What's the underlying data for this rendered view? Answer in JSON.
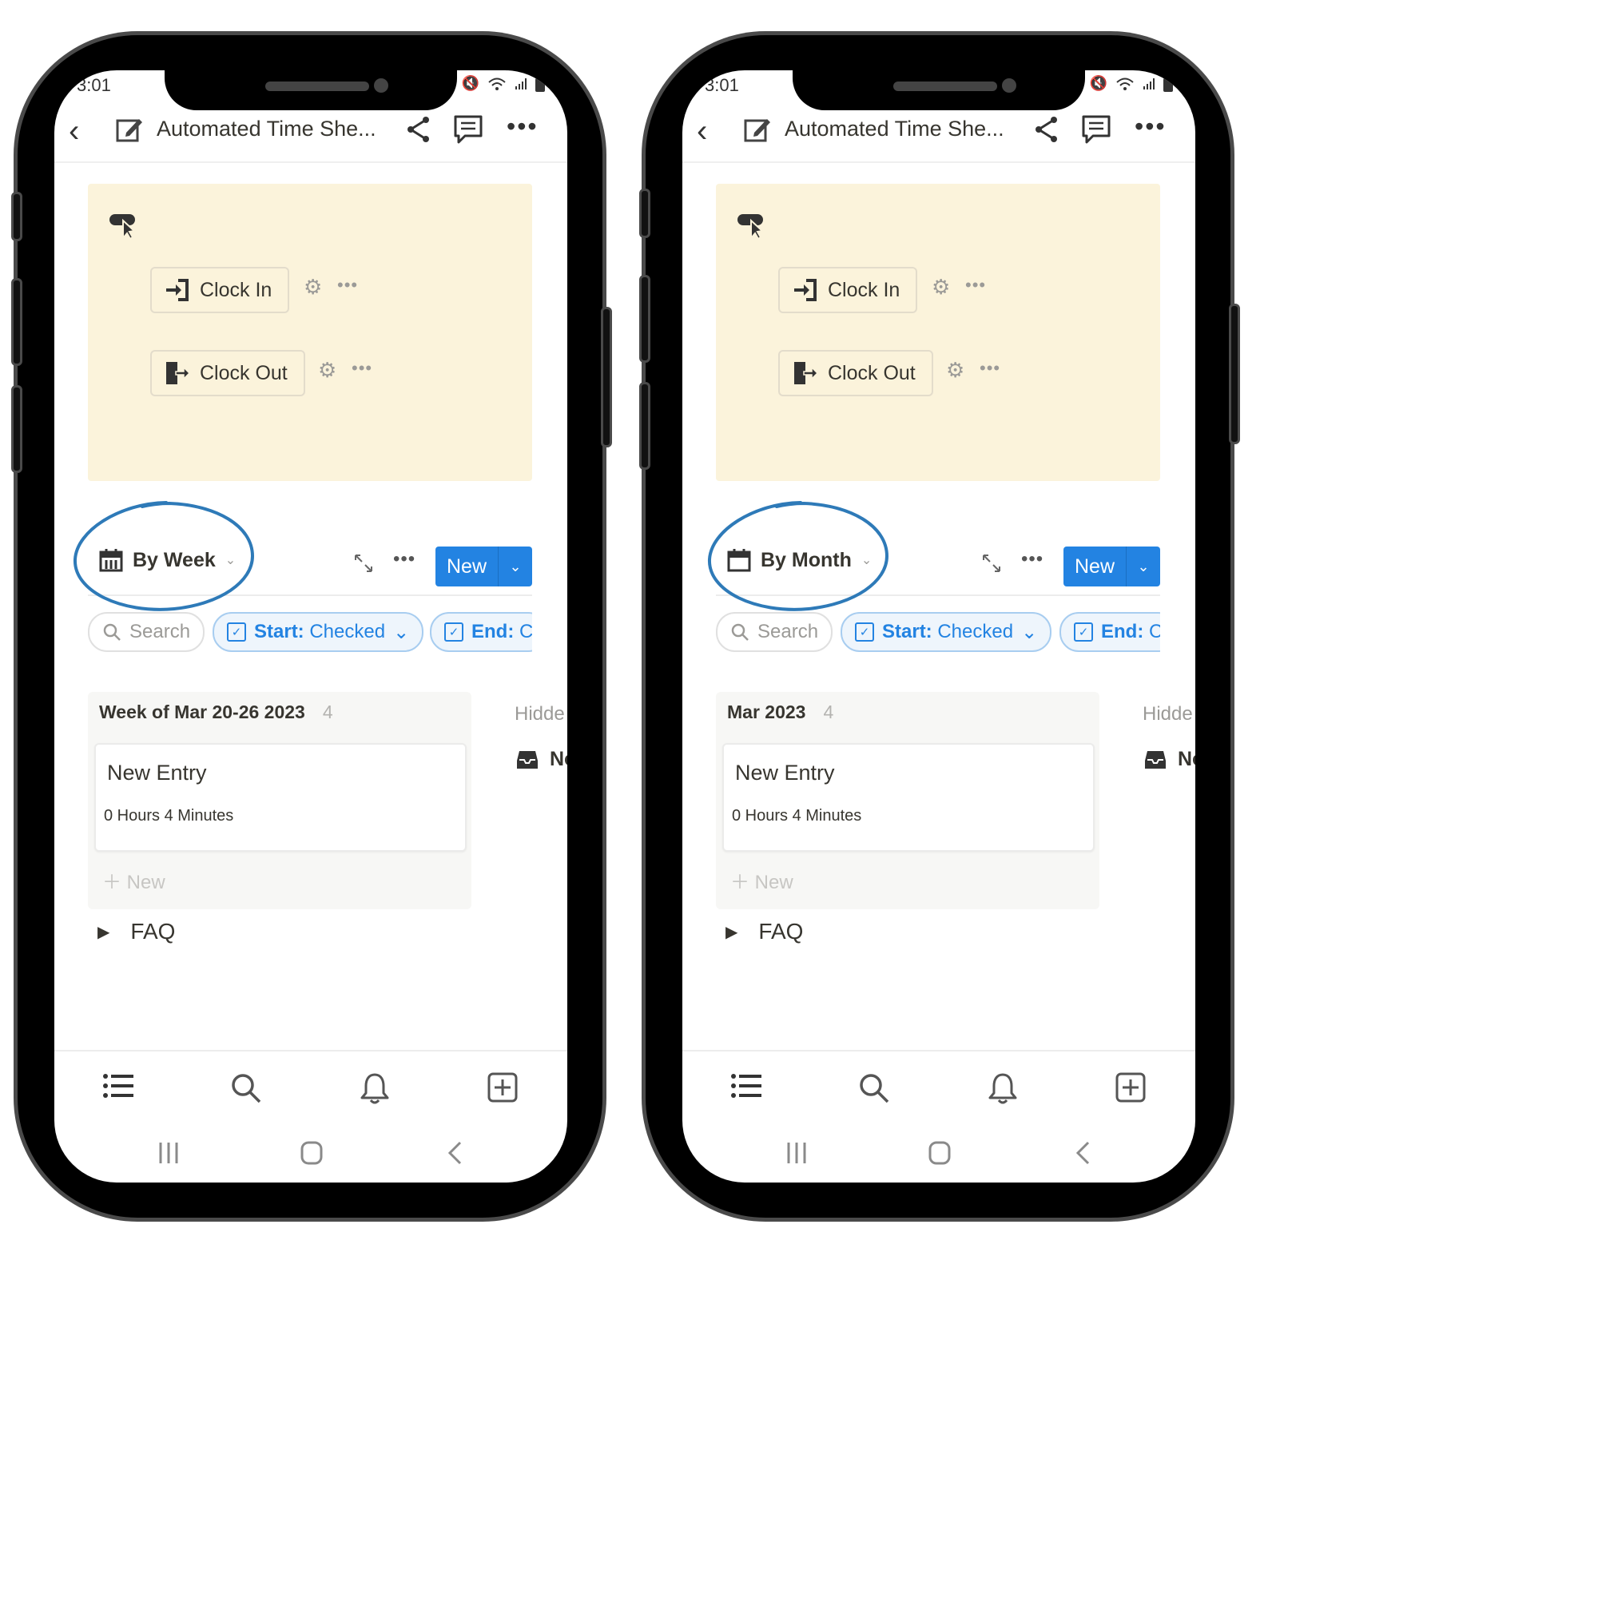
{
  "phones": [
    {
      "status": {
        "time": "3:01"
      },
      "header": {
        "title": "Automated Time She..."
      },
      "callout": {
        "clock_in": "Clock In",
        "clock_out": "Clock Out"
      },
      "view": {
        "label": "By Week",
        "new_button": "New"
      },
      "filters": {
        "search": "Search",
        "start_key": "Start:",
        "start_val": " Checked",
        "end_key": "End:",
        "end_val": " C"
      },
      "group": {
        "title": "Week of Mar 20-26 2023",
        "count": "4",
        "new_label": "New"
      },
      "card": {
        "title": "New Entry",
        "subtitle": "0 Hours 4 Minutes"
      },
      "hidden": {
        "label": "Hidde",
        "item": "No"
      },
      "faq": "FAQ"
    },
    {
      "status": {
        "time": "3:01"
      },
      "header": {
        "title": "Automated Time She..."
      },
      "callout": {
        "clock_in": "Clock In",
        "clock_out": "Clock Out"
      },
      "view": {
        "label": "By Month",
        "new_button": "New"
      },
      "filters": {
        "search": "Search",
        "start_key": "Start:",
        "start_val": " Checked",
        "end_key": "End:",
        "end_val": " C"
      },
      "group": {
        "title": "Mar 2023",
        "count": "4",
        "new_label": "New"
      },
      "card": {
        "title": "New Entry",
        "subtitle": "0 Hours 4 Minutes"
      },
      "hidden": {
        "label": "Hidde",
        "item": "No"
      },
      "faq": "FAQ"
    }
  ],
  "colors": {
    "accent": "#2383e2",
    "callout_bg": "#fbf3db",
    "annotation_circle": "#2e7ab8"
  }
}
